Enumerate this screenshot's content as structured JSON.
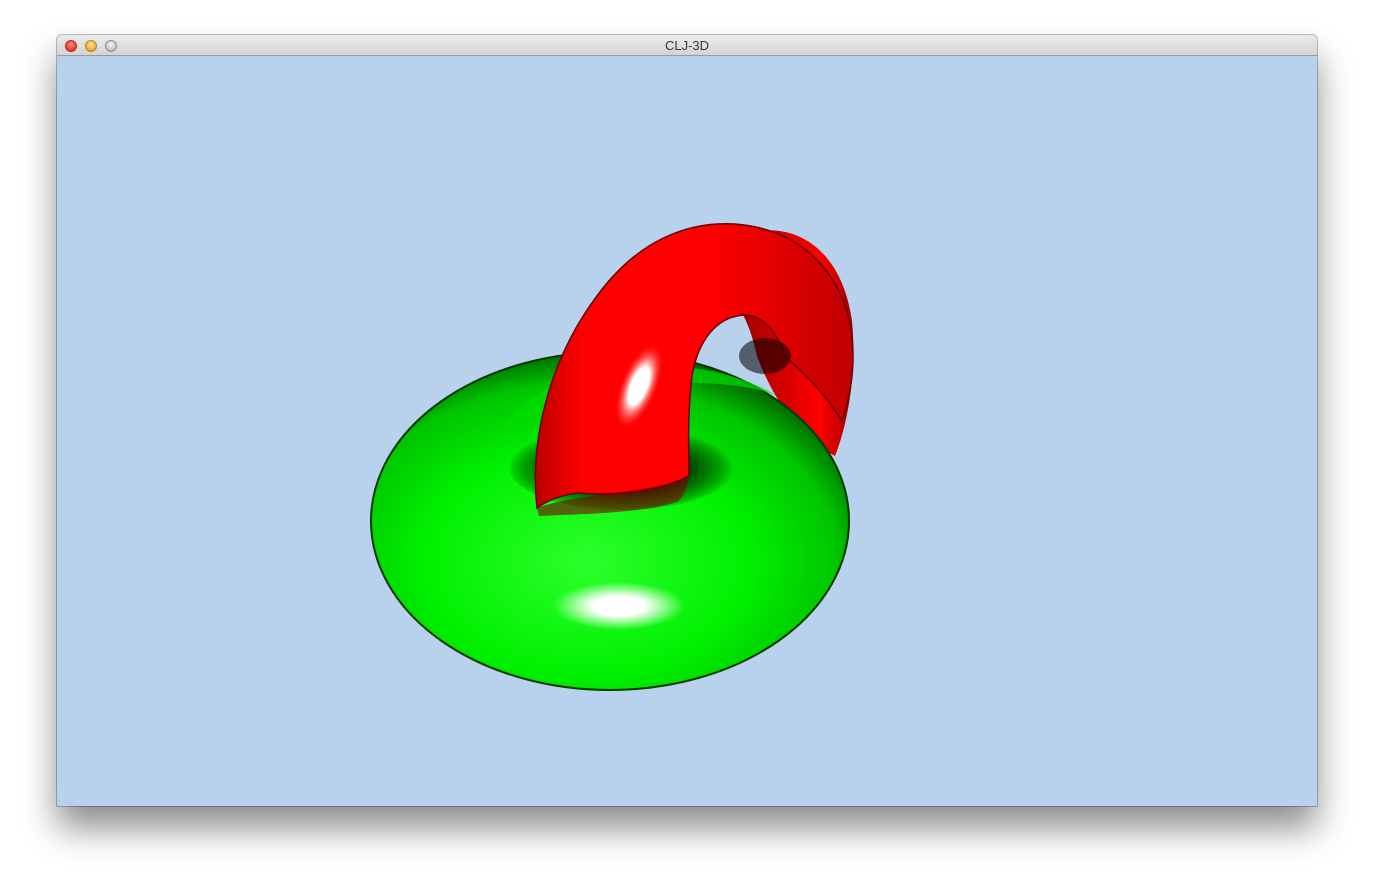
{
  "window": {
    "title": "CLJ-3D"
  },
  "scene": {
    "background_color": "#b8d1ec",
    "objects": [
      {
        "name": "green-torus",
        "color": "#00ff00"
      },
      {
        "name": "red-torus",
        "color": "#ff0000"
      }
    ]
  }
}
